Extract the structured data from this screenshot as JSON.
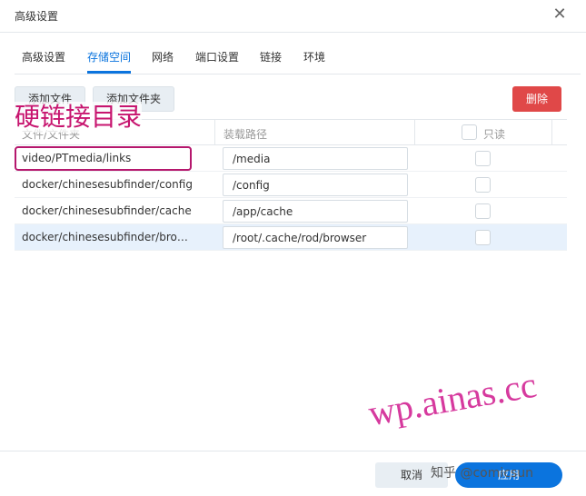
{
  "dialog": {
    "title": "高级设置",
    "close_symbol": "✕"
  },
  "tabs": [
    {
      "label": "高级设置",
      "active": false
    },
    {
      "label": "存储空间",
      "active": true
    },
    {
      "label": "网络",
      "active": false
    },
    {
      "label": "端口设置",
      "active": false
    },
    {
      "label": "链接",
      "active": false
    },
    {
      "label": "环境",
      "active": false
    }
  ],
  "toolbar": {
    "add_file_label": "添加文件",
    "add_folder_label": "添加文件夹",
    "delete_label": "删除"
  },
  "annotation": {
    "text": "硬链接目录"
  },
  "table": {
    "columns": [
      "文件/文件夹",
      "装载路径",
      "只读"
    ],
    "rows": [
      {
        "folder": "video/PTmedia/links",
        "mount": "/media",
        "readonly": false,
        "selected": false
      },
      {
        "folder": "docker/chinesesubfinder/config",
        "mount": "/config",
        "readonly": false,
        "selected": false
      },
      {
        "folder": "docker/chinesesubfinder/cache",
        "mount": "/app/cache",
        "readonly": false,
        "selected": false
      },
      {
        "folder": "docker/chinesesubfinder/bro…",
        "mount": "/root/.cache/rod/browser",
        "readonly": false,
        "selected": true
      }
    ]
  },
  "footer": {
    "cancel_label": "取消",
    "ok_label": "应用"
  },
  "watermarks": {
    "site": "wp.ainas.cc",
    "zhihu": "知乎 @comicsun"
  },
  "colors": {
    "accent": "#0b74de",
    "danger": "#e04848",
    "annotation": "#c7156f"
  }
}
